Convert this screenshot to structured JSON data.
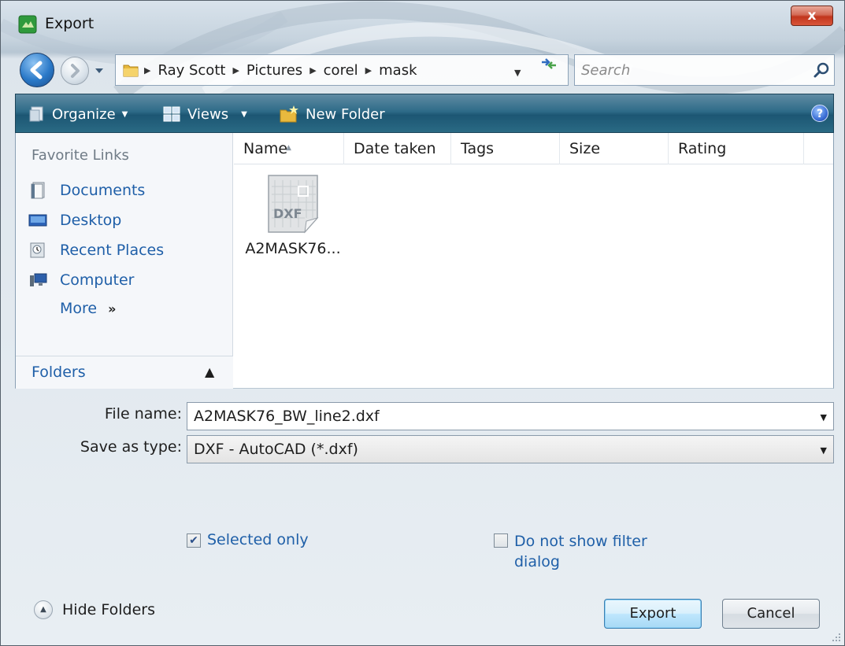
{
  "window": {
    "title": "Export",
    "close_label": "x"
  },
  "nav": {
    "breadcrumbs": [
      "Ray Scott",
      "Pictures",
      "corel",
      "mask"
    ],
    "search_placeholder": "Search"
  },
  "toolbar": {
    "organize": "Organize",
    "views": "Views",
    "new_folder": "New Folder",
    "help": "?"
  },
  "sidebar": {
    "heading": "Favorite Links",
    "items": [
      {
        "label": "Documents",
        "icon": "documents-icon"
      },
      {
        "label": "Desktop",
        "icon": "desktop-icon"
      },
      {
        "label": "Recent Places",
        "icon": "recent-places-icon"
      },
      {
        "label": "Computer",
        "icon": "computer-icon"
      }
    ],
    "more": "More",
    "more_glyph": "»",
    "folders": "Folders"
  },
  "columns": [
    "Name",
    "Date taken",
    "Tags",
    "Size",
    "Rating"
  ],
  "files": [
    {
      "name": "A2MASK76...",
      "type_badge": "DXF"
    }
  ],
  "form": {
    "file_name_label": "File name:",
    "file_name_value": "A2MASK76_BW_line2.dxf",
    "save_type_label": "Save as type:",
    "save_type_value": "DXF - AutoCAD (*.dxf)"
  },
  "options": {
    "selected_only": {
      "label": "Selected only",
      "checked": true
    },
    "no_filter_dialog": {
      "label_line1": "Do not show filter",
      "label_line2": "dialog",
      "checked": false
    }
  },
  "footer": {
    "hide_folders": "Hide Folders",
    "export": "Export",
    "cancel": "Cancel"
  }
}
